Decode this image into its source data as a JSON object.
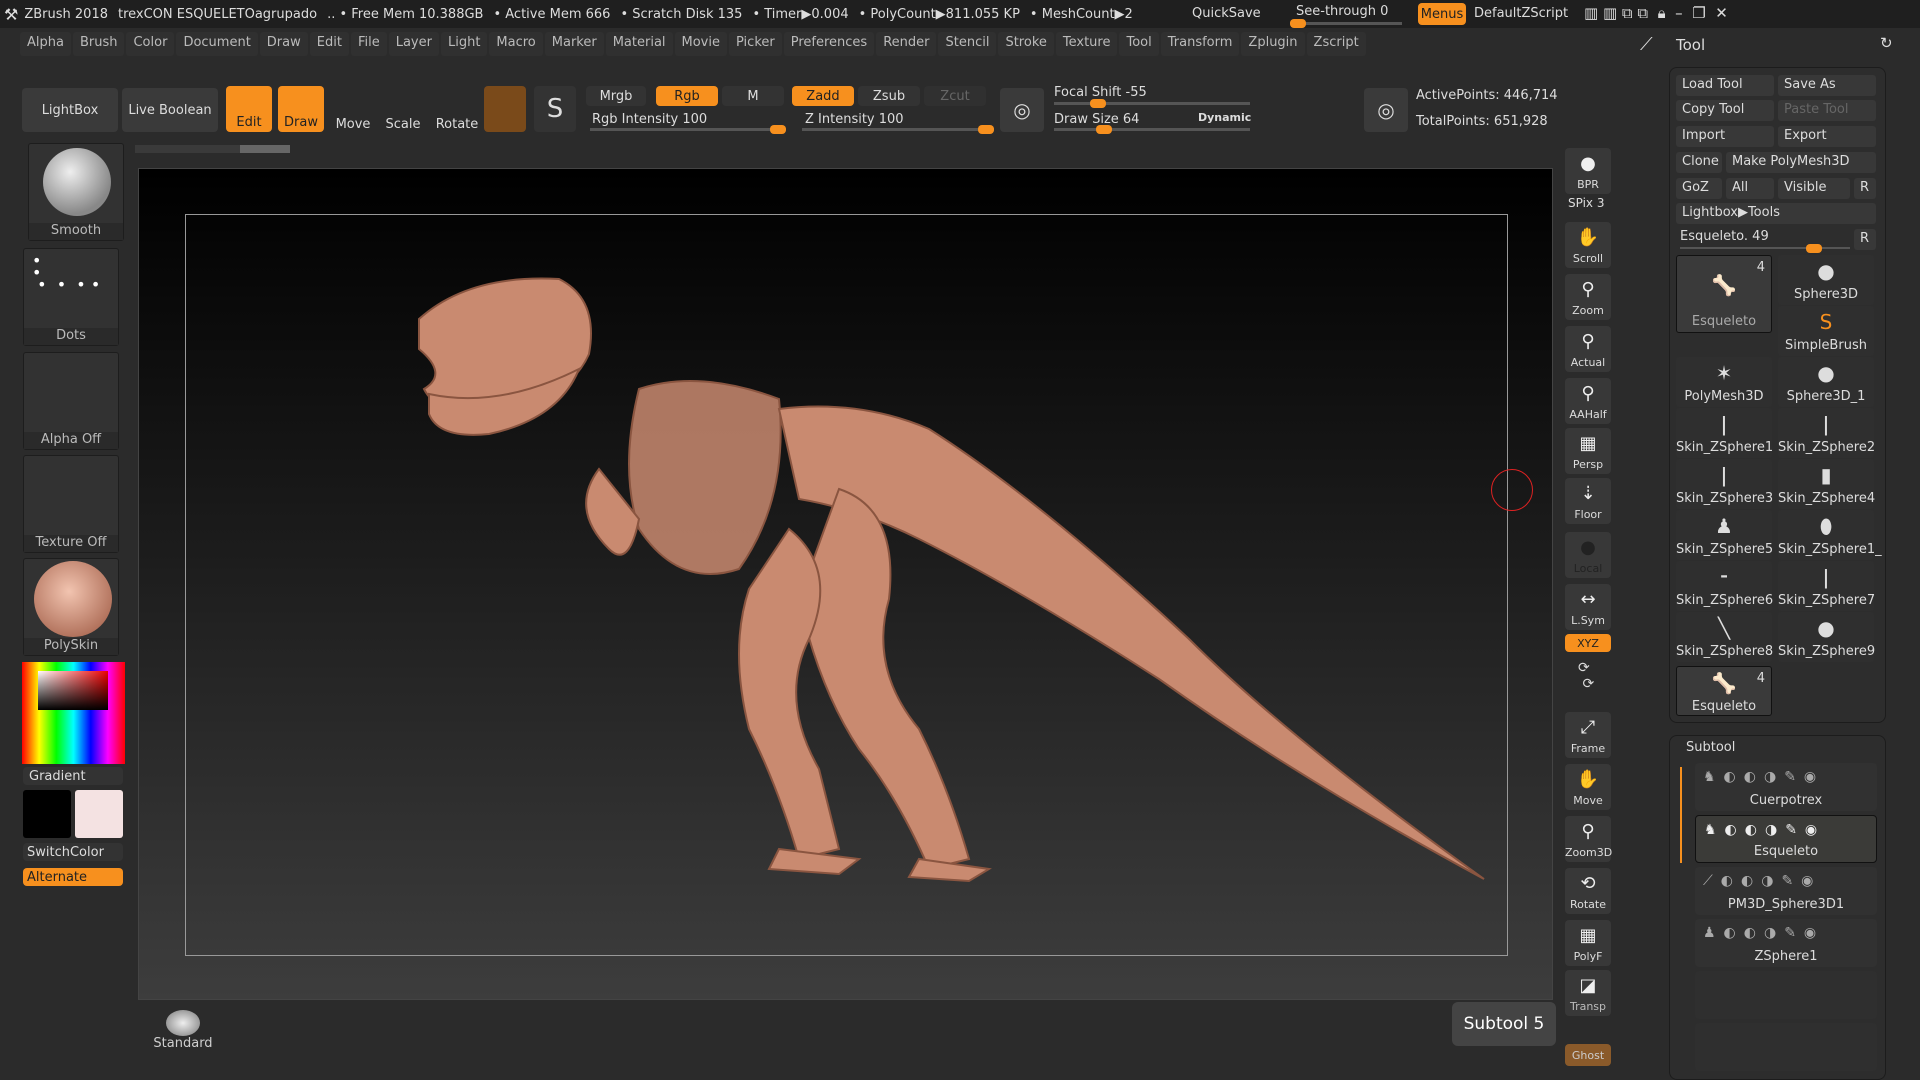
{
  "titlebar": {
    "app": "ZBrush 2018",
    "doc": "trexCON ESQUELETOagrupado",
    "free_mem": ".. • Free Mem 10.388GB",
    "active_mem": "• Active Mem 666",
    "scratch": "• Scratch Disk 135",
    "timer": "• Timer▶0.004",
    "polycount": "• PolyCount▶811.055 KP",
    "meshcount": "• MeshCount▶2",
    "quicksave": "QuickSave",
    "see_through": "See-through  0",
    "see_through_value": 0,
    "menus": "Menus",
    "default_zscript": "DefaultZScript"
  },
  "menu": [
    "Alpha",
    "Brush",
    "Color",
    "Document",
    "Draw",
    "Edit",
    "File",
    "Layer",
    "Light",
    "Macro",
    "Marker",
    "Material",
    "Movie",
    "Picker",
    "Preferences",
    "Render",
    "Stencil",
    "Stroke",
    "Texture",
    "Tool",
    "Transform",
    "Zplugin",
    "Zscript"
  ],
  "toolbar": {
    "lightbox": "LightBox",
    "live_boolean": "Live Boolean",
    "edit": "Edit",
    "draw": "Draw",
    "move": "Move",
    "scale": "Scale",
    "rotate": "Rotate",
    "mrgb": "Mrgb",
    "rgb": "Rgb",
    "m": "M",
    "zadd": "Zadd",
    "zsub": "Zsub",
    "zcut": "Zcut",
    "rgb_intensity": "Rgb Intensity 100",
    "z_intensity": "Z Intensity 100",
    "focal_shift": "Focal Shift -55",
    "draw_size": "Draw Size 64",
    "dynamic": "Dynamic",
    "active_points": "ActivePoints: 446,714",
    "total_points": "TotalPoints: 651,928"
  },
  "left": {
    "brush": "Smooth",
    "stroke": "Dots",
    "alpha": "Alpha Off",
    "texture": "Texture Off",
    "material": "PolySkin",
    "gradient": "Gradient",
    "switch_color": "SwitchColor",
    "alternate": "Alternate",
    "main_color": "#000000",
    "secondary_color": "#f4e2e2",
    "current_brush": "Standard"
  },
  "shelf": [
    "BPR",
    "SPix 3",
    "Scroll",
    "Zoom",
    "Actual",
    "AAHalf",
    "Persp",
    "Floor",
    "Local",
    "L.Sym",
    "XYZ",
    "Frame",
    "Move",
    "Zoom3D",
    "Rotate",
    "PolyF",
    "Transp",
    "Ghost"
  ],
  "tool": {
    "title": "Tool",
    "load": "Load Tool",
    "save_as": "Save As",
    "copy": "Copy Tool",
    "paste": "Paste Tool",
    "import": "Import",
    "export": "Export",
    "clone": "Clone",
    "make_polymesh": "Make PolyMesh3D",
    "goz": "GoZ",
    "all": "All",
    "visible": "Visible",
    "r": "R",
    "lightbox_tools": "Lightbox▶Tools",
    "slider": "Esqueleto. 49",
    "items": [
      {
        "name": "Esqueleto",
        "count": "4"
      },
      {
        "name": "Sphere3D"
      },
      {
        "name": "SimpleBrush"
      },
      {
        "name": "PolyMesh3D"
      },
      {
        "name": "Sphere3D_1"
      },
      {
        "name": "Skin_ZSphere1"
      },
      {
        "name": "Skin_ZSphere2"
      },
      {
        "name": "Skin_ZSphere3"
      },
      {
        "name": "Skin_ZSphere4"
      },
      {
        "name": "Skin_ZSphere5"
      },
      {
        "name": "Skin_ZSphere1_"
      },
      {
        "name": "Skin_ZSphere6"
      },
      {
        "name": "Skin_ZSphere7"
      },
      {
        "name": "Skin_ZSphere8"
      },
      {
        "name": "Skin_ZSphere9"
      },
      {
        "name": "Esqueleto",
        "count": "4"
      }
    ]
  },
  "subtool": {
    "title": "Subtool",
    "items": [
      "Cuerpotrex",
      "Esqueleto",
      "PM3D_Sphere3D1",
      "ZSphere1"
    ],
    "selected": "Esqueleto",
    "tooltip": "Subtool 5"
  },
  "colors": {
    "accent": "#f7901e",
    "bone": "#c98a70"
  }
}
